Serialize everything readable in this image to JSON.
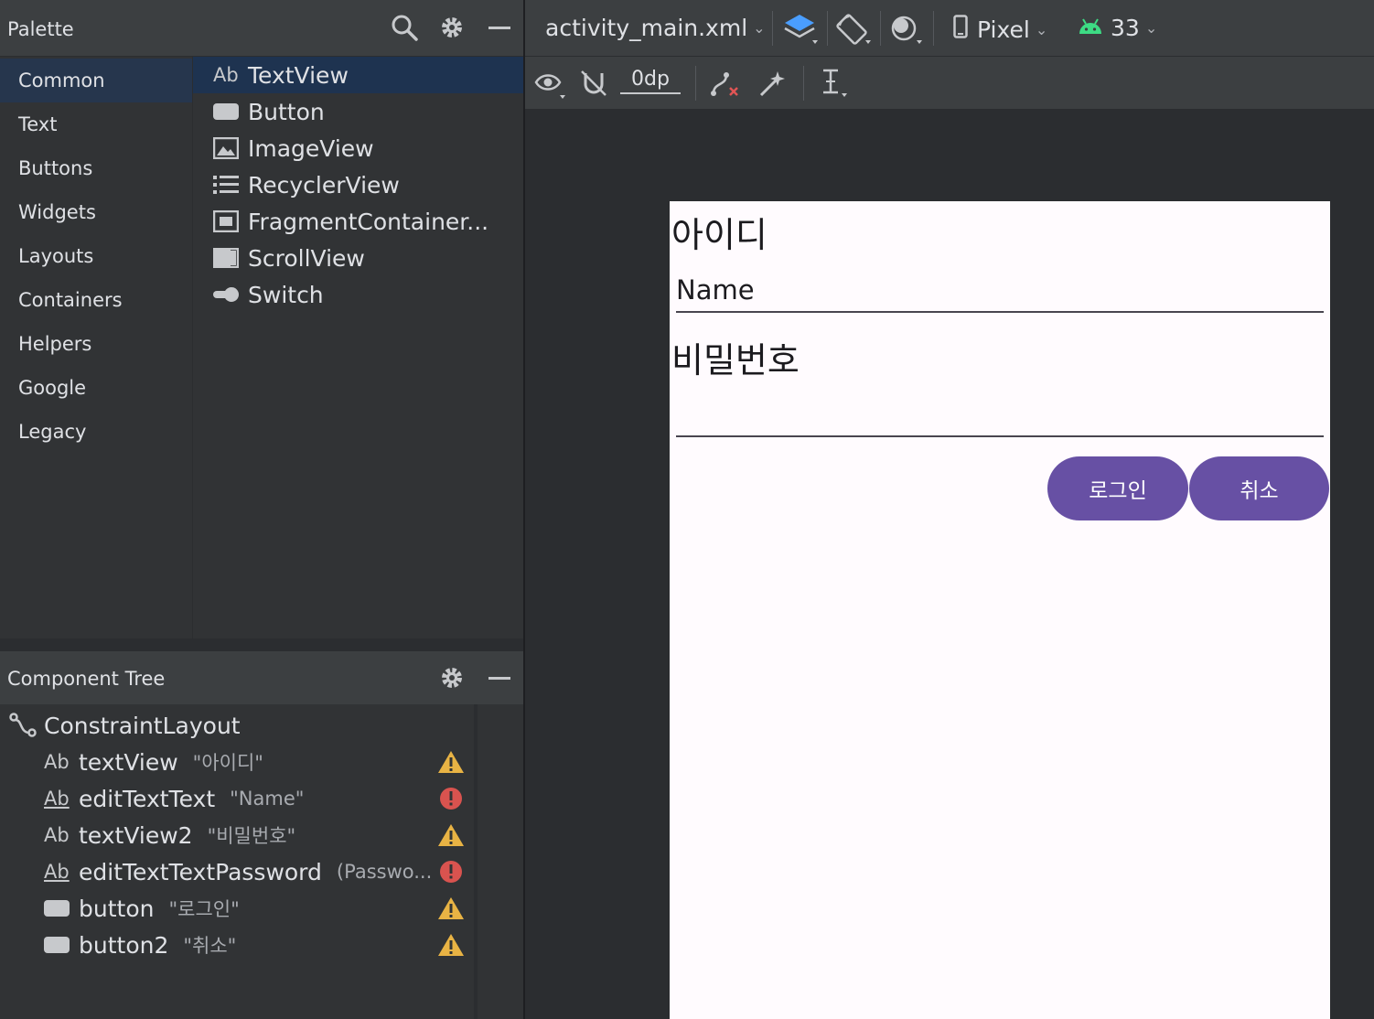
{
  "palette": {
    "title": "Palette",
    "categories": [
      {
        "label": "Common",
        "selected": true
      },
      {
        "label": "Text"
      },
      {
        "label": "Buttons"
      },
      {
        "label": "Widgets"
      },
      {
        "label": "Layouts"
      },
      {
        "label": "Containers"
      },
      {
        "label": "Helpers"
      },
      {
        "label": "Google"
      },
      {
        "label": "Legacy"
      }
    ],
    "widgets": [
      {
        "label": "TextView",
        "icon": "textview-icon",
        "icon_text": "Ab",
        "selected": true
      },
      {
        "label": "Button",
        "icon": "button-icon"
      },
      {
        "label": "ImageView",
        "icon": "imageview-icon"
      },
      {
        "label": "RecyclerView",
        "icon": "recyclerview-icon"
      },
      {
        "label": "FragmentContainer...",
        "icon": "fragmentcontainer-icon"
      },
      {
        "label": "ScrollView",
        "icon": "scrollview-icon"
      },
      {
        "label": "Switch",
        "icon": "switch-icon"
      }
    ]
  },
  "component_tree": {
    "title": "Component Tree",
    "root": {
      "label": "ConstraintLayout",
      "icon": "constraintlayout-icon"
    },
    "items": [
      {
        "type_icon_text": "Ab",
        "name": "textView",
        "detail": "\"아이디\"",
        "status": "warning",
        "icon": "textview-icon"
      },
      {
        "type_icon_text": "Ab",
        "name": "editTextText",
        "detail": "\"Name\"",
        "status": "error",
        "icon": "edittext-icon"
      },
      {
        "type_icon_text": "Ab",
        "name": "textView2",
        "detail": "\"비밀번호\"",
        "status": "warning",
        "icon": "textview-icon"
      },
      {
        "type_icon_text": "Ab",
        "name": "editTextTextPassword",
        "detail": "(Passwo...",
        "status": "error",
        "icon": "edittext-icon"
      },
      {
        "type_icon_text": "",
        "name": "button",
        "detail": "\"로그인\"",
        "status": "warning",
        "icon": "button-icon"
      },
      {
        "type_icon_text": "",
        "name": "button2",
        "detail": "\"취소\"",
        "status": "warning",
        "icon": "button-icon"
      }
    ]
  },
  "toolbar": {
    "file": "activity_main.xml",
    "device": "Pixel",
    "api": "33",
    "margin": "0dp"
  },
  "preview": {
    "id_label": "아이디",
    "name_value": "Name",
    "password_label": "비밀번호",
    "login_button": "로그인",
    "cancel_button": "취소"
  },
  "colors": {
    "accent_button": "#6750a4",
    "warning": "#e8b344",
    "error": "#d9534f",
    "android_green": "#3ddc84",
    "design_icon_blue": "#4a9eff"
  }
}
